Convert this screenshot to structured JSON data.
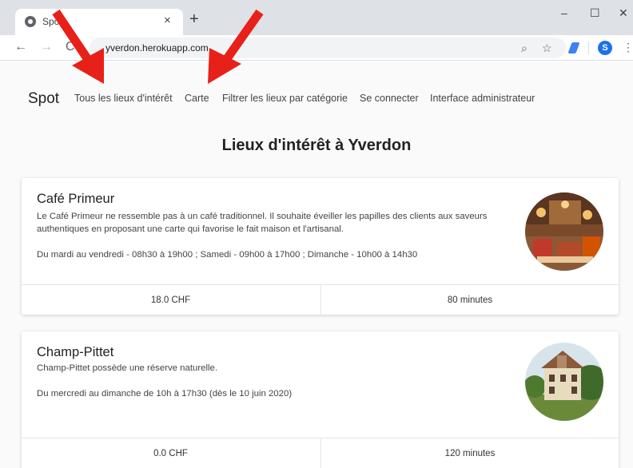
{
  "browser": {
    "tab_title": "Spot",
    "tab_close": "×",
    "new_tab": "+",
    "url": "yverdon.herokuapp.com",
    "back": "←",
    "forward": "→",
    "reload": "C",
    "zoom_icon": "⌕",
    "star_icon": "☆",
    "profile_initial": "S",
    "menu_icon": "⋮",
    "minimize": "–",
    "maximize": "☐",
    "close": "✕"
  },
  "navbar": {
    "brand": "Spot",
    "links": [
      "Tous les lieux d'intérêt",
      "Carte",
      "Filtrer les lieux par catégorie",
      "Se connecter",
      "Interface administrateur"
    ]
  },
  "main": {
    "title": "Lieux d'intérêt à Yverdon",
    "places": [
      {
        "name": "Café Primeur",
        "description": "Le Café Primeur ne ressemble pas à un café traditionnel. Il souhaite éveiller les papilles des clients aux saveurs authentiques en proposant une carte qui favorise le fait maison et l'artisanal.",
        "hours": "Du mardi au vendredi - 08h30 à 19h00 ; Samedi - 09h00 à 17h00 ; Dimanche - 10h00 à 14h30",
        "price": "18.0 CHF",
        "duration": "80 minutes"
      },
      {
        "name": "Champ-Pittet",
        "description": "Champ-Pittet possède une réserve naturelle.",
        "hours": "Du mercredi au dimanche de 10h à 17h30 (dès le 10 juin 2020)",
        "price": "0.0 CHF",
        "duration": "120 minutes"
      }
    ]
  },
  "colors": {
    "arrow": "#e8201a",
    "accent": "#1a73e8"
  }
}
